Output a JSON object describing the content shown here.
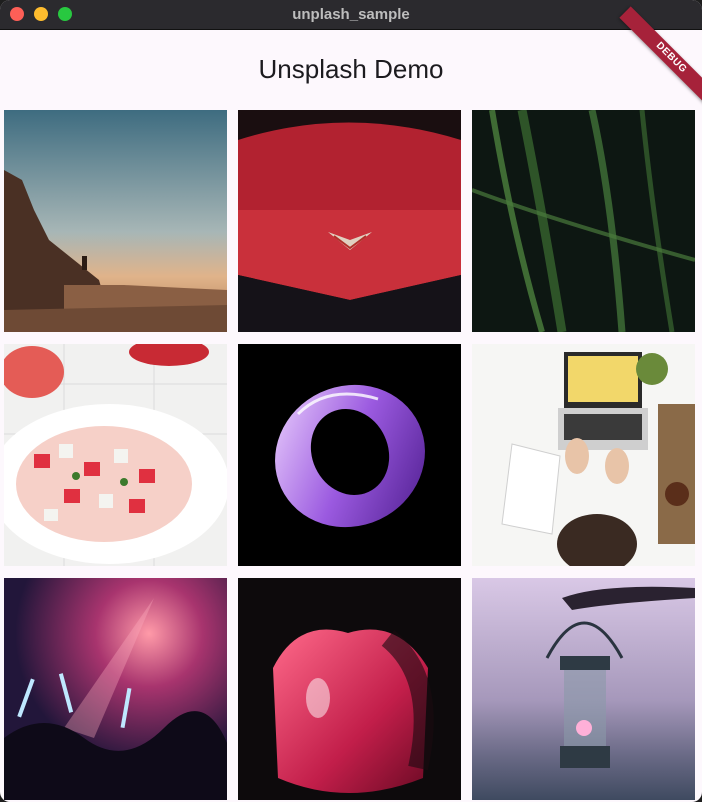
{
  "window": {
    "title": "unplash_sample",
    "controls": [
      "close",
      "minimize",
      "maximize"
    ]
  },
  "appbar": {
    "title": "Unsplash Demo",
    "debug_banner": "DEBUG"
  },
  "photos": [
    {
      "subject": "desert-canyon-sunset"
    },
    {
      "subject": "red-corvette-emblem"
    },
    {
      "subject": "green-grass-dew"
    },
    {
      "subject": "watermelon-feta-salad"
    },
    {
      "subject": "purple-glass-ring"
    },
    {
      "subject": "laptop-workspace"
    },
    {
      "subject": "concert-crowd-lights"
    },
    {
      "subject": "pink-abstract-shape"
    },
    {
      "subject": "lantern-at-dusk"
    }
  ]
}
